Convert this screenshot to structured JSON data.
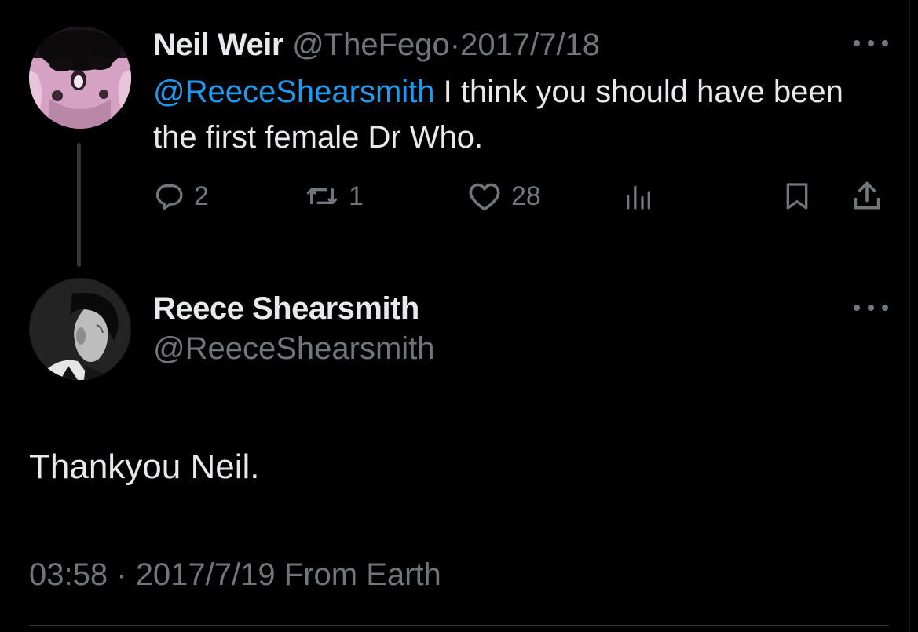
{
  "parent_tweet": {
    "author_name": "Neil Weir",
    "author_handle": "@TheFego",
    "separator": "·",
    "date": "2017/7/18",
    "mention": "@ReeceShearsmith",
    "text": " I think you should have been the first female Dr Who.",
    "replies": "2",
    "retweets": "1",
    "likes": "28",
    "avatar_icon": "pink-face-avatar"
  },
  "reply_tweet": {
    "author_name": "Reece Shearsmith",
    "author_handle": "@ReeceShearsmith",
    "text": "Thankyou Neil.",
    "time": "03:58",
    "separator": "·",
    "date": "2017/7/19",
    "source": "From Earth",
    "avatar_icon": "portrait-avatar"
  },
  "icons": {
    "reply": "reply-icon",
    "retweet": "retweet-icon",
    "like": "heart-icon",
    "views": "views-icon",
    "bookmark": "bookmark-icon",
    "share": "share-icon",
    "more": "more-icon"
  },
  "colors": {
    "background": "#000000",
    "text": "#e7e9ea",
    "muted": "#71767b",
    "link": "#1d9bf0",
    "thread_line": "#333639"
  }
}
